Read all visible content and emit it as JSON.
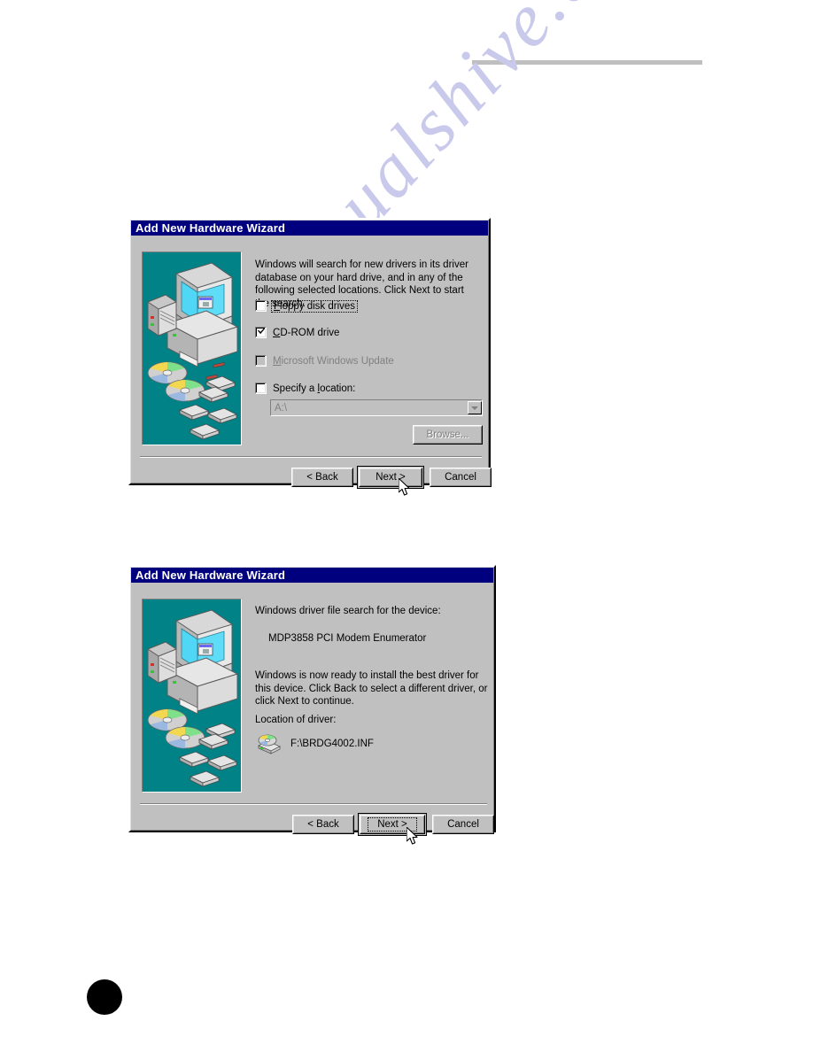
{
  "page": {
    "rule": "horizontal-rule",
    "page_marker": "black-dot"
  },
  "watermark": {
    "text": "manualshive.com"
  },
  "dialog1": {
    "title": "Add New Hardware Wizard",
    "intro": "Windows will search for new drivers in its driver database on your hard drive, and in any of the following selected locations. Click Next to start the search.",
    "checkboxes": [
      {
        "label": "Floppy disk drives",
        "accel": "F",
        "checked": false,
        "disabled": false,
        "focused": true
      },
      {
        "label": "CD-ROM drive",
        "accel": "C",
        "checked": true,
        "disabled": false,
        "focused": false
      },
      {
        "label": "Microsoft Windows Update",
        "accel": "M",
        "checked": false,
        "disabled": true,
        "focused": false
      },
      {
        "label": "Specify a location:",
        "accel": "l",
        "checked": false,
        "disabled": false,
        "focused": false
      }
    ],
    "location_combo": {
      "value": "A:\\",
      "placeholder": "A:\\",
      "disabled": true
    },
    "browse_button": {
      "label": "Browse...",
      "disabled": true
    },
    "buttons": {
      "back": "< Back",
      "next": "Next >",
      "cancel": "Cancel"
    },
    "graphic": "computer-cds-chips-illustration"
  },
  "dialog2": {
    "title": "Add New Hardware Wizard",
    "line1": "Windows driver file search for the device:",
    "device_name": "MDP3858 PCI Modem Enumerator",
    "paragraph": "Windows is now ready to install the best driver for this device. Click Back to select a different driver, or click Next to continue.",
    "location_label": "Location of driver:",
    "driver_path": "F:\\BRDG4002.INF",
    "driver_icon": "cdrom-drive-icon",
    "buttons": {
      "back": "< Back",
      "next": "Next >",
      "cancel": "Cancel"
    },
    "graphic": "computer-cds-chips-illustration"
  },
  "colors": {
    "titlebar": "#00007e",
    "dialog_face": "#c0c0c0",
    "graphic_teal": "#008286",
    "watermark": "#c9c9ec",
    "disabled_text": "#808080"
  }
}
